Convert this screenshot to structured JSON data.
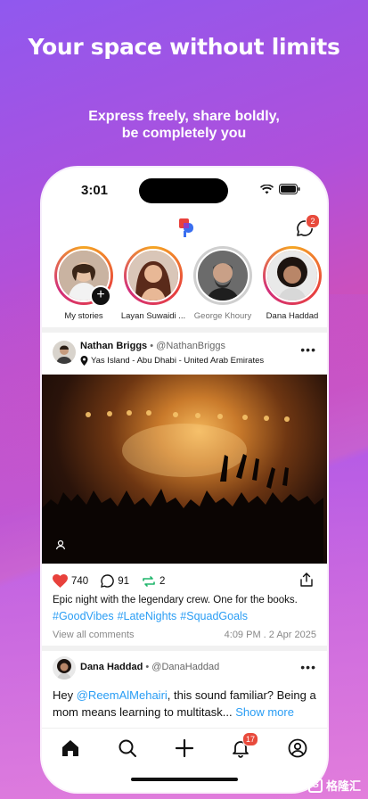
{
  "hero": {
    "headline": "Your space without limits",
    "sub_line1": "Express freely, share boldly,",
    "sub_line2": "be completely you"
  },
  "status_bar": {
    "time": "3:01"
  },
  "header": {
    "messages_badge": "2"
  },
  "stories": [
    {
      "name": "My stories",
      "seen": false,
      "own": true
    },
    {
      "name": "Layan Suwaidi ...",
      "seen": false
    },
    {
      "name": "George Khoury",
      "seen": true
    },
    {
      "name": "Dana Haddad",
      "seen": false
    }
  ],
  "post1": {
    "author": "Nathan Briggs",
    "handle": "@NathanBriggs",
    "location": "Yas Island - Abu Dhabi - United Arab Emirates",
    "likes": "740",
    "comments": "91",
    "reposts": "2",
    "caption": "Epic night with the legendary crew. One for the books.",
    "hashtags": [
      "#GoodVibes",
      "#LateNights",
      "#SquadGoals"
    ],
    "view_comments": "View all comments",
    "timestamp": "4:09 PM . 2 Apr 2025"
  },
  "post2": {
    "author": "Dana Haddad",
    "handle": "@DanaHaddad",
    "text_before": "Hey ",
    "mention": "@ReemAlMehairi",
    "text_after": ", this sound familiar? Being a mom means learning to multitask... ",
    "show_more": "Show more"
  },
  "tabbar": {
    "notifications_badge": "17"
  },
  "watermark": {
    "text": "格隆汇"
  },
  "colors": {
    "accent": "#2a9df4",
    "badge": "#e84a3c",
    "like": "#e8413c",
    "repost": "#1fb56b"
  }
}
